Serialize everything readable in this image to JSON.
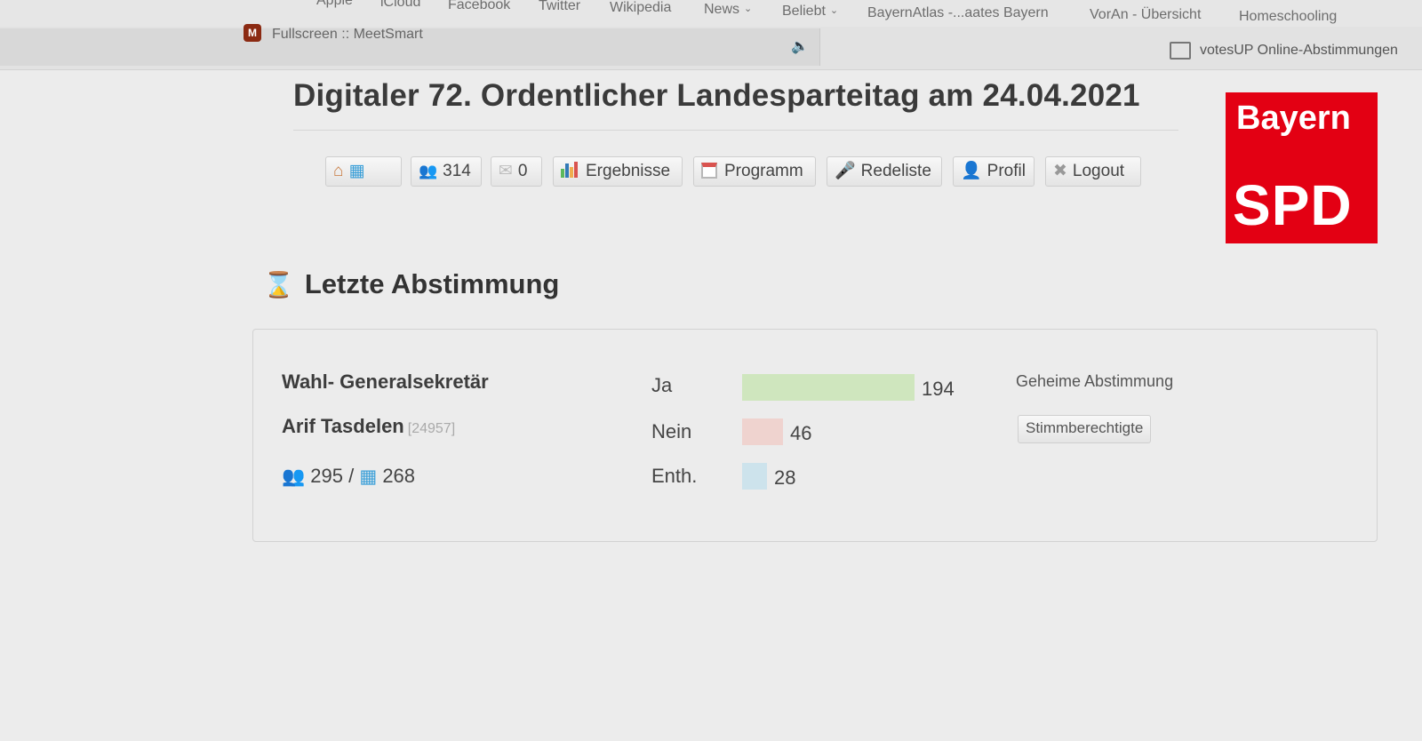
{
  "browser": {
    "bookmarks": [
      {
        "label": "Apple",
        "dropdown": false
      },
      {
        "label": "iCloud",
        "dropdown": false
      },
      {
        "label": "Facebook",
        "dropdown": false
      },
      {
        "label": "Twitter",
        "dropdown": false
      },
      {
        "label": "Wikipedia",
        "dropdown": false
      },
      {
        "label": "News",
        "dropdown": true
      },
      {
        "label": "Beliebt",
        "dropdown": true
      },
      {
        "label": "BayernAtlas -...aates Bayern",
        "dropdown": false
      },
      {
        "label": "VorAn - Übersicht",
        "dropdown": false
      },
      {
        "label": "Homeschooling",
        "dropdown": false
      }
    ],
    "tabs": [
      {
        "title": "Fullscreen :: MeetSmart",
        "active": true
      },
      {
        "title": "votesUP Online-Abstimmungen",
        "active": false
      }
    ]
  },
  "header": {
    "title": "Digitaler 72. Ordentlicher Landesparteitag am 24.04.2021",
    "logo_top": "Bayern",
    "logo_bottom": "SPD",
    "logo_color": "#e30013"
  },
  "nav": {
    "participants_count": "314",
    "messages_count": "0",
    "results_label": "Ergebnisse",
    "program_label": "Programm",
    "speakers_label": "Redeliste",
    "profile_label": "Profil",
    "logout_label": "Logout"
  },
  "section": {
    "title": "Letzte Abstimmung"
  },
  "vote": {
    "title": "Wahl- Generalsekretär",
    "candidate": "Arif Tasdelen",
    "candidate_id": "[24957]",
    "participants": "295 /",
    "ballots": "268",
    "secret_label": "Geheime Abstimmung",
    "eligible_label": "Stimmberechtigte",
    "options": [
      {
        "label": "Ja",
        "value": 194,
        "color": "#cfe6be"
      },
      {
        "label": "Nein",
        "value": 46,
        "color": "#efd3cf"
      },
      {
        "label": "Enth.",
        "value": 28,
        "color": "#cde3ec"
      }
    ]
  }
}
